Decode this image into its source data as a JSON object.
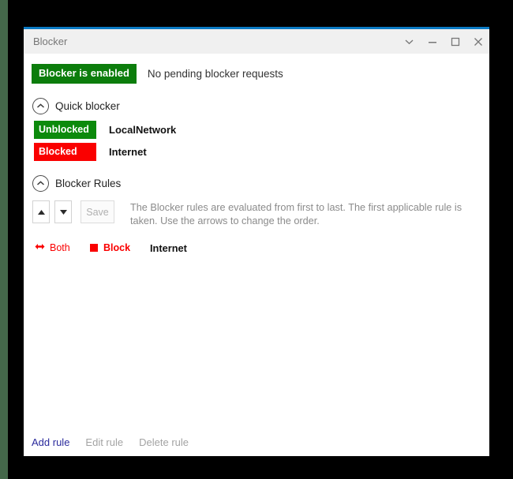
{
  "window": {
    "title": "Blocker",
    "controls": [
      {
        "name": "dropdown-chevron",
        "icon": "chevron-down-icon"
      },
      {
        "name": "minimize",
        "icon": "minimize-icon"
      },
      {
        "name": "maximize",
        "icon": "maximize-icon"
      },
      {
        "name": "close",
        "icon": "close-icon"
      }
    ],
    "accent_color": "#0b7ac4"
  },
  "status": {
    "badge_label": "Blocker is enabled",
    "badge_color": "#0c7d0c",
    "note": "No pending blocker requests"
  },
  "quick_blocker": {
    "title": "Quick blocker",
    "collapse_icon": "chevron-up-circle-icon",
    "entries": [
      {
        "state": "Unblocked",
        "state_color": "#0c8a0c",
        "name": "LocalNetwork"
      },
      {
        "state": "Blocked",
        "state_color": "#fa0000",
        "name": "Internet"
      }
    ]
  },
  "blocker_rules": {
    "title": "Blocker Rules",
    "collapse_icon": "chevron-up-circle-icon",
    "toolbar": {
      "move_up_label": "▲",
      "move_down_label": "▼",
      "save_label": "Save",
      "save_enabled": false
    },
    "description": "The Blocker rules are evaluated from first to last. The first applicable rule is taken. Use the arrows to change the order.",
    "rules": [
      {
        "direction": "Both",
        "direction_icon": "left-right-arrow-icon",
        "action": "Block",
        "action_icon": "red-square-icon",
        "action_color": "#fa0000",
        "target": "Internet"
      }
    ]
  },
  "footer": {
    "links": [
      {
        "label": "Add rule",
        "enabled": true
      },
      {
        "label": "Edit rule",
        "enabled": false
      },
      {
        "label": "Delete rule",
        "enabled": false
      }
    ]
  }
}
